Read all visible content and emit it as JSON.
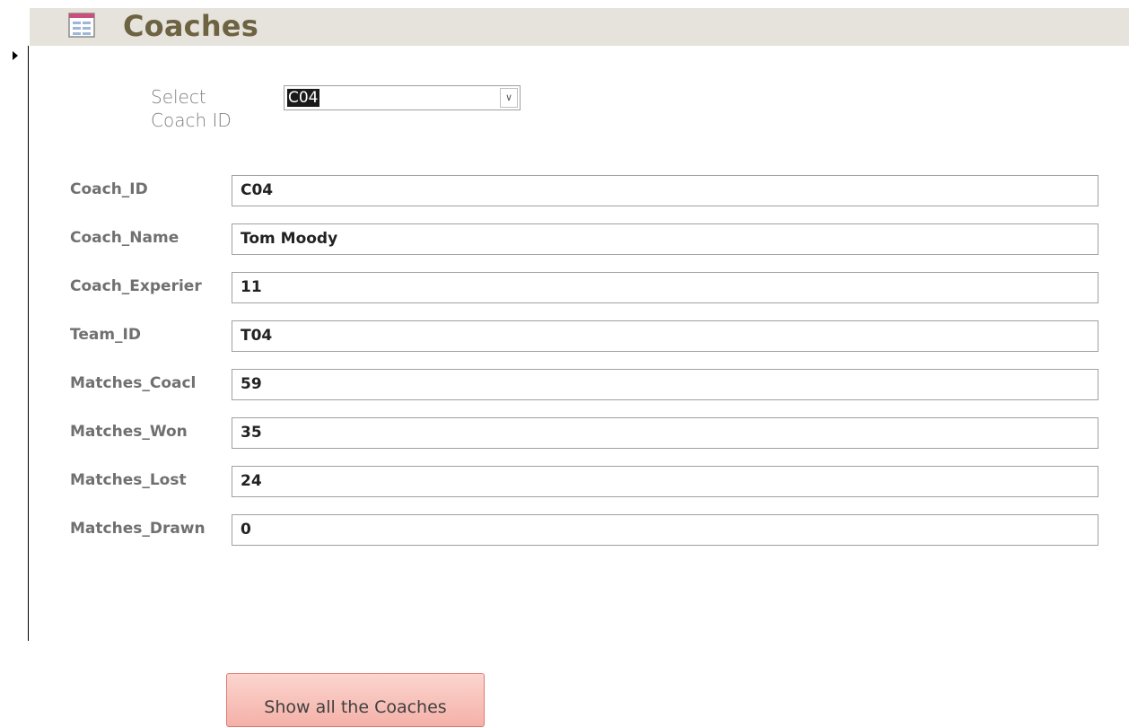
{
  "form": {
    "title": "Coaches"
  },
  "select": {
    "label": "Select Coach ID",
    "value": "C04"
  },
  "fields": [
    {
      "label": "Coach_ID",
      "value": "C04"
    },
    {
      "label": "Coach_Name",
      "value": "Tom Moody"
    },
    {
      "label": "Coach_Experier",
      "value": "11"
    },
    {
      "label": "Team_ID",
      "value": "T04"
    },
    {
      "label": "Matches_Coacl",
      "value": "59"
    },
    {
      "label": "Matches_Won",
      "value": "35"
    },
    {
      "label": "Matches_Lost",
      "value": "24"
    },
    {
      "label": "Matches_Drawn",
      "value": "0"
    }
  ],
  "buttons": {
    "show_all": "Show all the Coaches"
  },
  "colors": {
    "header_bg": "#e6e3dc",
    "title": "#6d6242",
    "button_bg": "#f4b1a8"
  }
}
